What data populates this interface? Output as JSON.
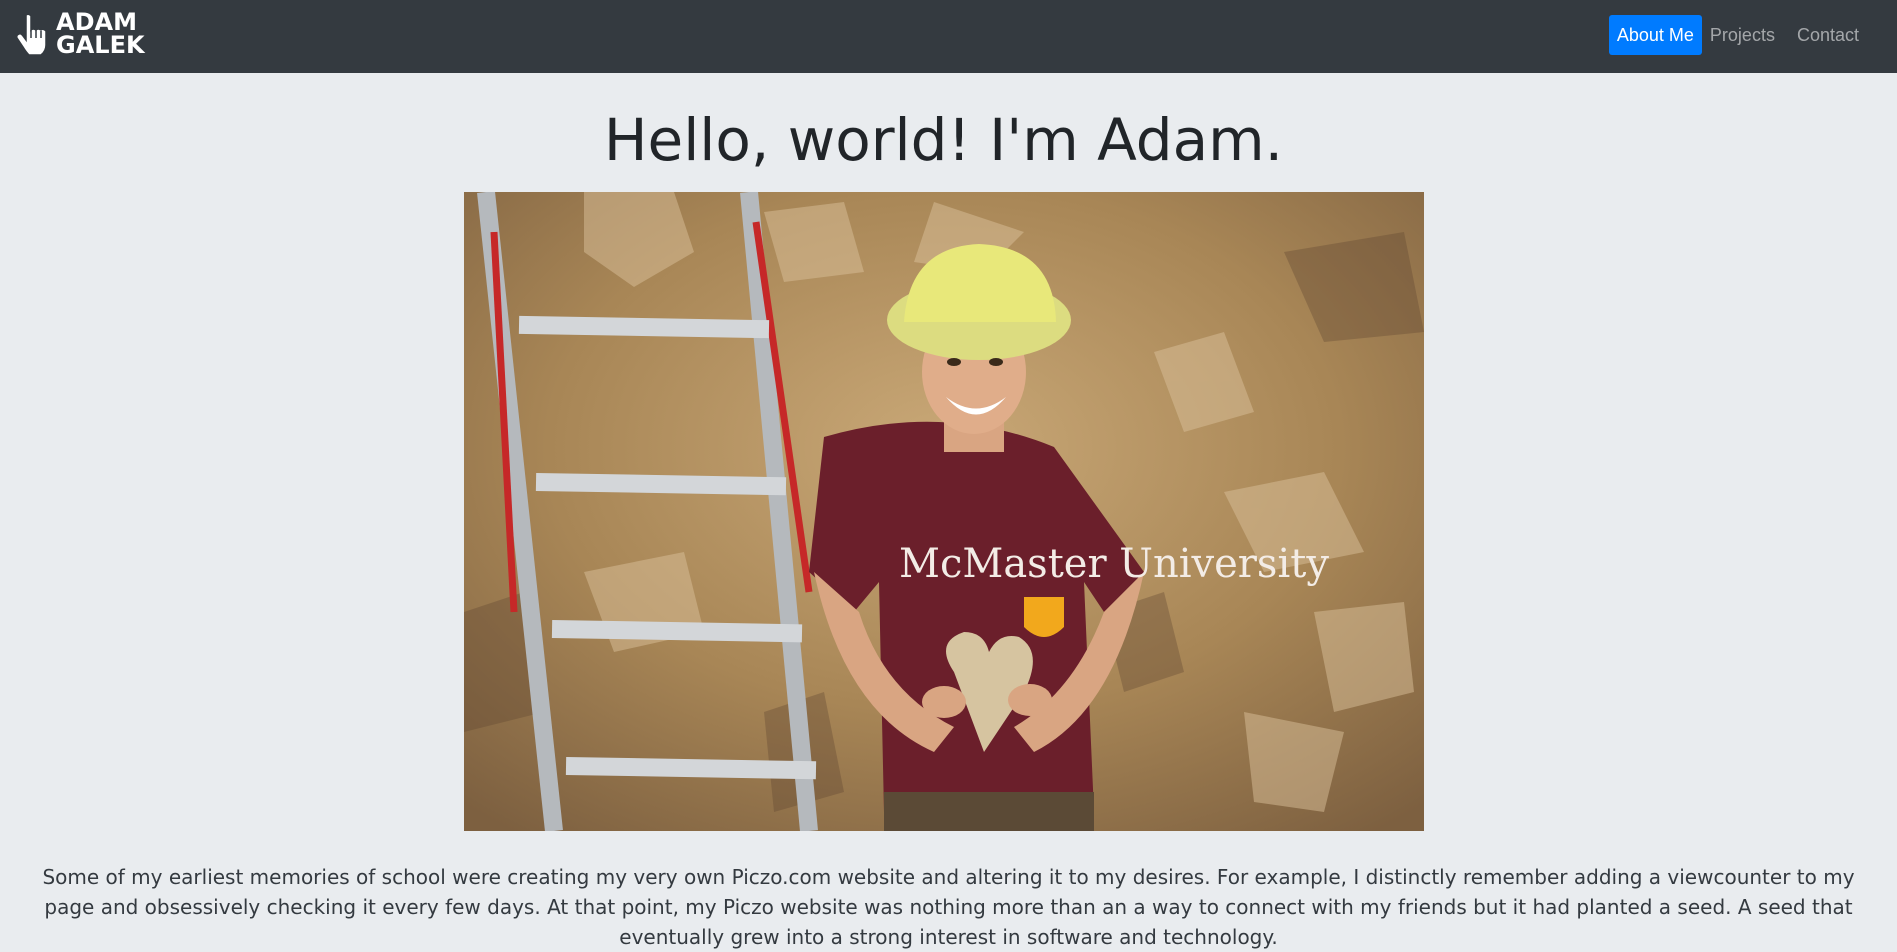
{
  "brand": {
    "line1": "ADAM",
    "line2": "GALEK",
    "icon": "pointing-hand-icon"
  },
  "nav": {
    "items": [
      {
        "label": "About Me",
        "active": true
      },
      {
        "label": "Projects",
        "active": false
      },
      {
        "label": "Contact",
        "active": false
      }
    ],
    "active_color": "#007bff"
  },
  "hero": {
    "title": "Hello, world! I'm Adam.",
    "photo_caption": "McMaster University"
  },
  "bio": {
    "text": "Some of my earliest memories of school were creating my very own Piczo.com website and altering it to my desires. For example, I distinctly remember adding a viewcounter to my page and obsessively checking it every few days. At that point, my Piczo website was nothing more than an a way to connect with my friends but it had planted a seed. A seed that eventually grew into a strong interest in software and technology."
  },
  "colors": {
    "navbar": "#343a40",
    "background": "#e9ecef",
    "text": "#212529"
  }
}
